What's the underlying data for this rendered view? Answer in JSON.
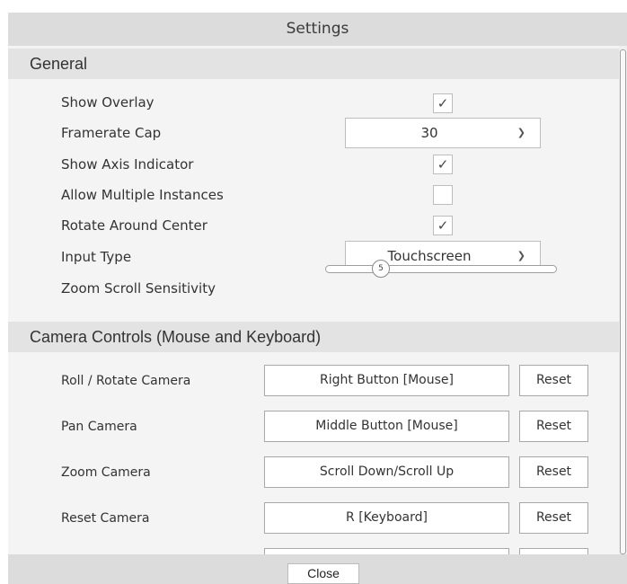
{
  "dialog": {
    "title": "Settings",
    "close_label": "Close"
  },
  "general": {
    "header": "General",
    "show_overlay": {
      "label": "Show Overlay",
      "checked": true
    },
    "framerate_cap": {
      "label": "Framerate Cap",
      "value": "30"
    },
    "show_axis_indicator": {
      "label": "Show Axis Indicator",
      "checked": true
    },
    "allow_multiple_instances": {
      "label": "Allow Multiple Instances",
      "checked": false
    },
    "rotate_around_center": {
      "label": "Rotate Around Center",
      "checked": true
    },
    "input_type": {
      "label": "Input Type",
      "value": "Touchscreen"
    },
    "zoom_scroll_sensitivity": {
      "label": "Zoom Scroll Sensitivity",
      "value": "5"
    }
  },
  "camera_controls": {
    "header": "Camera Controls (Mouse and Keyboard)",
    "reset_label": "Reset",
    "bindings": [
      {
        "label": "Roll / Rotate Camera",
        "value": "Right Button [Mouse]"
      },
      {
        "label": "Pan Camera",
        "value": "Middle Button [Mouse]"
      },
      {
        "label": "Zoom Camera",
        "value": "Scroll Down/Scroll Up"
      },
      {
        "label": "Reset Camera",
        "value": "R [Keyboard]"
      }
    ]
  },
  "icons": {
    "checkbox_check": "check-icon",
    "dropdown_arrow": "chevron-down-icon"
  }
}
